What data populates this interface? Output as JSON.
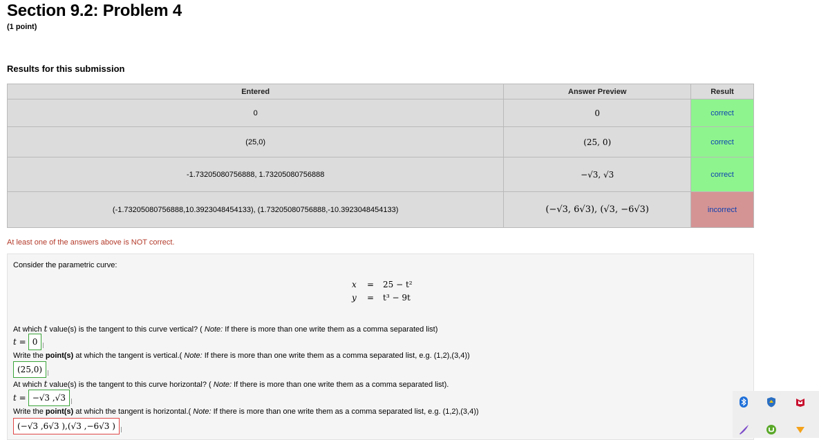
{
  "header": {
    "title": "Section 9.2: Problem 4",
    "points": "(1 point)"
  },
  "results": {
    "heading": "Results for this submission",
    "columns": [
      "Entered",
      "Answer Preview",
      "Result"
    ],
    "rows": [
      {
        "entered": "0",
        "preview": "0",
        "result": "correct"
      },
      {
        "entered": "(25,0)",
        "preview": "(25, 0)",
        "result": "correct"
      },
      {
        "entered": "-1.73205080756888, 1.73205080756888",
        "preview": "−√3, √3",
        "result": "correct"
      },
      {
        "entered": "(-1.73205080756888,10.3923048454133), (1.73205080756888,-10.3923048454133)",
        "preview": "(−√3, 6√3), (√3, −6√3)",
        "result": "incorrect"
      }
    ],
    "warning": "At least one of the answers above is NOT correct."
  },
  "problem": {
    "intro": "Consider the parametric curve:",
    "equations": [
      {
        "lhs": "x",
        "eq": "=",
        "rhs": "25 − t²"
      },
      {
        "lhs": "y",
        "eq": "=",
        "rhs": "t³ − 9t"
      }
    ],
    "q1": {
      "pre": "At which ",
      "var": "t",
      "post": " value(s) is the tangent to this curve vertical? ( ",
      "note_label": "Note:",
      "note": " If there is more than one write them as a comma separated list)",
      "answer_label": "t =",
      "answer": "0"
    },
    "q2": {
      "pre": "Write the ",
      "bold": "point(s)",
      "post": " at which the tangent is vertical.( ",
      "note_label": "Note:",
      "note": " If there is more than one write them as a comma separated list, e.g. (1,2),(3,4))",
      "answer": "(25,0)"
    },
    "q3": {
      "pre": "At which ",
      "var": "t",
      "post": " value(s) is the tangent to this curve horizontal? ( ",
      "note_label": "Note:",
      "note": " If there is more than one write them as a comma separated list).",
      "answer_label": "t =",
      "answer": "−√3 ,√3"
    },
    "q4": {
      "pre": "Write the ",
      "bold": "point(s)",
      "post": " at which the tangent is horizontal.( ",
      "note_label": "Note:",
      "note": " If there is more than one write them as a comma separated list, e.g. (1,2),(3,4))",
      "answer": "(−√3 ,6√3 ),(√3 ,−6√3 )"
    }
  },
  "tray": {
    "icons": [
      "bluetooth-icon",
      "security-shield-icon",
      "mcafee-icon",
      "pen-icon",
      "utorrent-icon",
      "dropdown-arrow-icon"
    ]
  },
  "colors": {
    "correct_bg": "#8ef58e",
    "incorrect_bg": "#d49494",
    "result_text": "#0d3fb0",
    "warning_text": "#b33a2a"
  }
}
